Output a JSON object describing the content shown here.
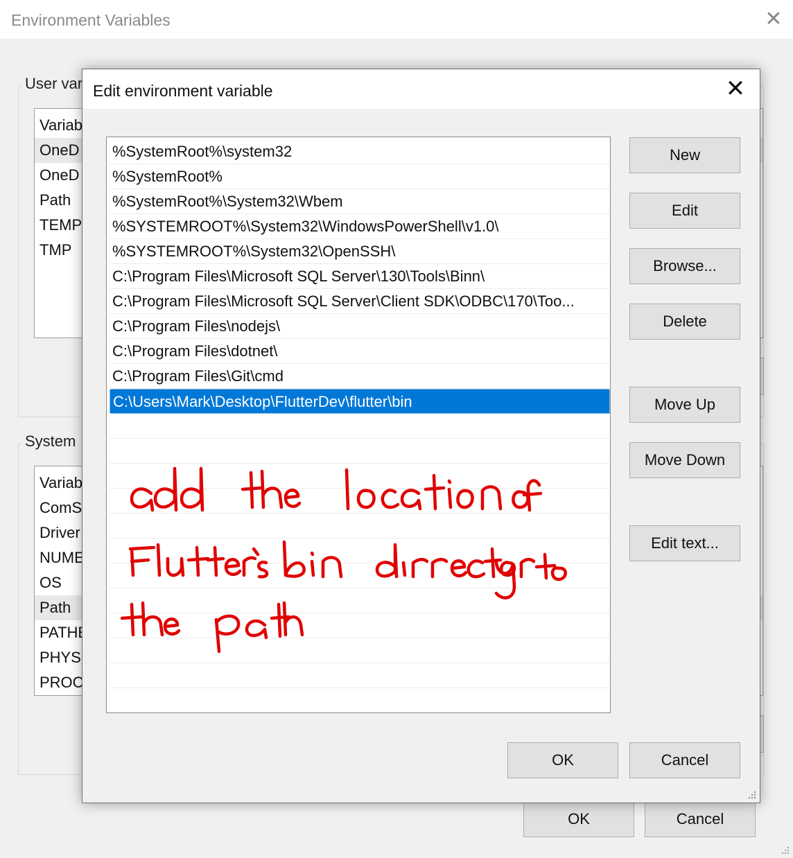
{
  "background_window": {
    "title": "Environment Variables",
    "user_group_label": "User var",
    "user_list": [
      "Variab",
      "OneD",
      "OneD",
      "Path",
      "TEMP",
      "TMP"
    ],
    "system_group_label": "System",
    "system_list": [
      "Variab",
      "ComS",
      "Driver",
      "NUME",
      "OS",
      "Path",
      "PATHE",
      "PHYS",
      "PROC"
    ],
    "ok_label": "OK",
    "cancel_label": "Cancel"
  },
  "dialog": {
    "title": "Edit environment variable",
    "paths": [
      "%SystemRoot%\\system32",
      "%SystemRoot%",
      "%SystemRoot%\\System32\\Wbem",
      "%SYSTEMROOT%\\System32\\WindowsPowerShell\\v1.0\\",
      "%SYSTEMROOT%\\System32\\OpenSSH\\",
      "C:\\Program Files\\Microsoft SQL Server\\130\\Tools\\Binn\\",
      "C:\\Program Files\\Microsoft SQL Server\\Client SDK\\ODBC\\170\\Too...",
      "C:\\Program Files\\nodejs\\",
      "C:\\Program Files\\dotnet\\",
      "C:\\Program Files\\Git\\cmd",
      "C:\\Users\\Mark\\Desktop\\FlutterDev\\flutter\\bin"
    ],
    "selected_index": 10,
    "buttons": {
      "new": "New",
      "edit": "Edit",
      "browse": "Browse...",
      "delete": "Delete",
      "move_up": "Move Up",
      "move_down": "Move Down",
      "edit_text": "Edit text..."
    },
    "ok_label": "OK",
    "cancel_label": "Cancel"
  },
  "annotation": {
    "color": "#e00000",
    "lines": [
      "add the location of",
      "Flutter's bin directory to",
      "the path"
    ]
  },
  "colors": {
    "selection": "#0078d7"
  }
}
